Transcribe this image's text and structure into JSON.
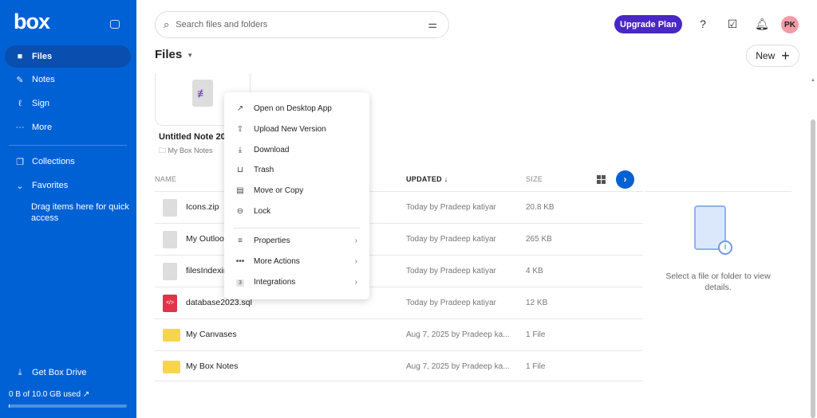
{
  "brand": {
    "logo": "box",
    "accent": "#0061d5"
  },
  "sidebar": {
    "items": [
      {
        "label": "Files",
        "icon": "folder-icon"
      },
      {
        "label": "Notes",
        "icon": "notes-icon"
      },
      {
        "label": "Sign",
        "icon": "sign-icon"
      },
      {
        "label": "More",
        "icon": "more-icon"
      },
      {
        "label": "Collections",
        "icon": "collections-icon"
      },
      {
        "label": "Favorites",
        "icon": "chevron-down-icon"
      }
    ],
    "favorites_hint": "Drag items here for quick access",
    "get_drive": "Get Box Drive",
    "usage": "0 B of 10.0 GB used",
    "usage_fraction": 0.01
  },
  "header": {
    "search_placeholder": "Search files and folders",
    "upgrade": "Upgrade Plan",
    "avatar": "PK"
  },
  "page": {
    "title": "Files",
    "new_label": "New"
  },
  "recent": {
    "title": "Untitled Note 2025",
    "location": "My Box Notes"
  },
  "table": {
    "headers": {
      "name": "NAME",
      "updated": "UPDATED",
      "size": "SIZE"
    },
    "rows": [
      {
        "name": "Icons.zip",
        "updated": "Today by Pradeep katiyar",
        "size": "20.8 KB",
        "type": "file"
      },
      {
        "name": "My Outlook",
        "updated": "Today by Pradeep katiyar",
        "size": "265 KB",
        "type": "file"
      },
      {
        "name": "filesIndexing",
        "updated": "Today by Pradeep katiyar",
        "size": "4 KB",
        "type": "file"
      },
      {
        "name": "database2023.sql",
        "updated": "Today by Pradeep katiyar",
        "size": "12 KB",
        "type": "sql"
      },
      {
        "name": "My Canvases",
        "updated": "Aug 7, 2025 by Pradeep ka...",
        "size": "1 File",
        "type": "folder"
      },
      {
        "name": "My Box Notes",
        "updated": "Aug 7, 2025 by Pradeep ka...",
        "size": "1 File",
        "type": "folder"
      }
    ]
  },
  "details_panel": {
    "empty_text": "Select a file or folder to view details."
  },
  "context_menu": {
    "items": [
      {
        "label": "Open on Desktop App",
        "icon": "external-link-icon"
      },
      {
        "label": "Upload New Version",
        "icon": "upload-icon"
      },
      {
        "label": "Download",
        "icon": "download-icon"
      },
      {
        "label": "Trash",
        "icon": "trash-icon"
      },
      {
        "label": "Move or Copy",
        "icon": "copy-icon"
      },
      {
        "label": "Lock",
        "icon": "lock-icon"
      },
      {
        "label": "Properties",
        "icon": "properties-icon"
      },
      {
        "label": "More Actions",
        "icon": "more-icon"
      },
      {
        "label": "Integrations",
        "icon": "integrations-badge",
        "badge": "3"
      }
    ]
  }
}
